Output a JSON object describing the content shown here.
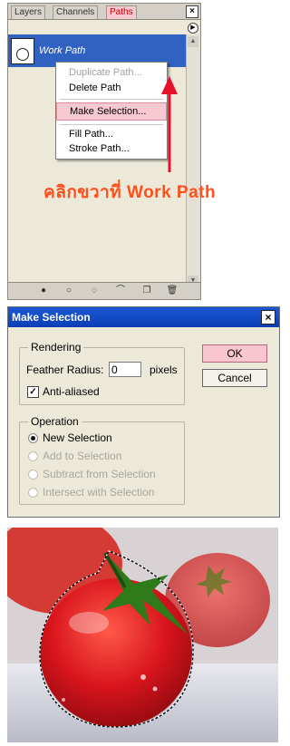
{
  "palette": {
    "tabs": [
      "Layers",
      "Channels",
      "Paths"
    ],
    "active_tab": "Paths",
    "close_symbol": "×",
    "path_name": "Work Path",
    "context_menu": [
      {
        "label": "Duplicate Path...",
        "state": "disabled"
      },
      {
        "label": "Delete Path",
        "state": "normal"
      },
      {
        "label": "Make Selection...",
        "state": "highlighted"
      },
      {
        "label": "Fill Path...",
        "state": "normal"
      },
      {
        "label": "Stroke Path...",
        "state": "normal"
      }
    ],
    "bottom_icons": [
      "fill-path-icon",
      "stroke-path-icon",
      "load-selection-icon",
      "make-work-path-icon",
      "new-path-icon",
      "trash-icon"
    ]
  },
  "caption": "คลิกขวาที่ Work Path",
  "dialog": {
    "title": "Make Selection",
    "close_symbol": "×",
    "rendering": {
      "legend": "Rendering",
      "feather_label": "Feather Radius:",
      "feather_value": "0",
      "feather_unit": "pixels",
      "anti_aliased_label": "Anti-aliased",
      "anti_aliased_checked": true
    },
    "operation": {
      "legend": "Operation",
      "options": [
        {
          "label": "New Selection",
          "selected": true,
          "enabled": true
        },
        {
          "label": "Add to Selection",
          "selected": false,
          "enabled": false
        },
        {
          "label": "Subtract from Selection",
          "selected": false,
          "enabled": false
        },
        {
          "label": "Intersect with Selection",
          "selected": false,
          "enabled": false
        }
      ]
    },
    "ok_label": "OK",
    "cancel_label": "Cancel"
  },
  "colors": {
    "accent_blue": "#3162c2",
    "highlight_pink": "#f9c9d3",
    "caption_orange": "#ff4f1a",
    "arrow_red": "#e8112d"
  }
}
